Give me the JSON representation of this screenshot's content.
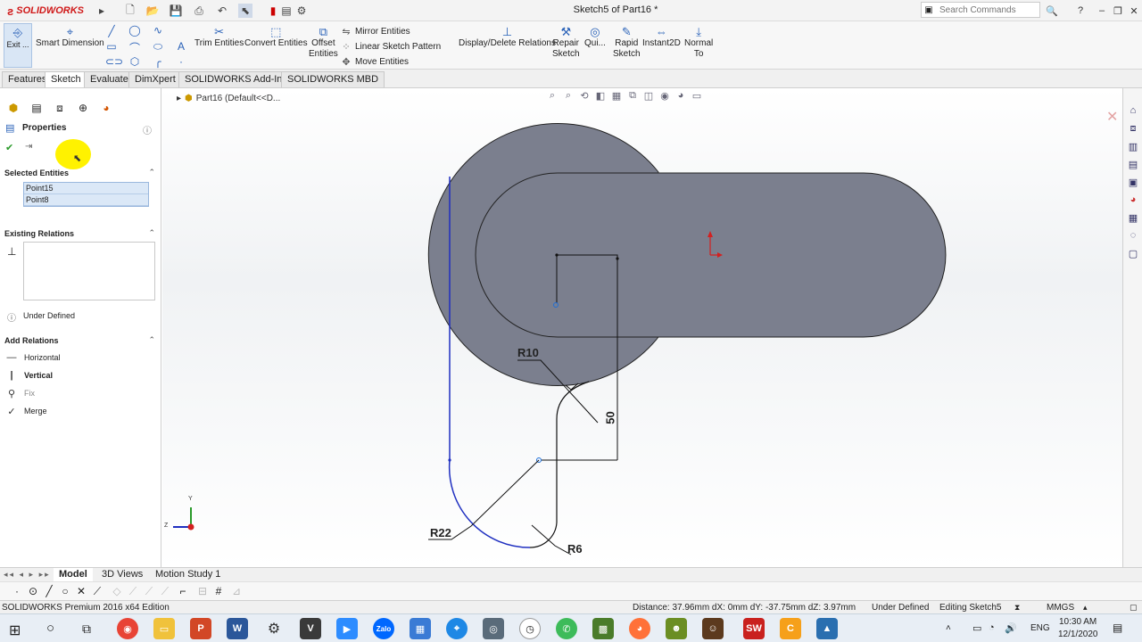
{
  "titlebar": {
    "app_name": "SOLIDWORKS",
    "window_title": "Sketch5 of Part16 *",
    "search_placeholder": "Search Commands",
    "help": "?"
  },
  "ribbon": {
    "exit_sketch": "Exit ...",
    "smart_dimension": "Smart Dimension",
    "trim_entities": "Trim Entities",
    "convert_entities": "Convert Entities",
    "offset_entities_1": "Offset",
    "offset_entities_2": "Entities",
    "mirror_entities": "Mirror Entities",
    "linear_pattern": "Linear Sketch Pattern",
    "move_entities": "Move Entities",
    "display_delete_relations": "Display/Delete Relations",
    "repair_sketch_1": "Repair",
    "repair_sketch_2": "Sketch",
    "quick_snaps": "Qui...",
    "rapid_sketch_1": "Rapid",
    "rapid_sketch_2": "Sketch",
    "instant2d": "Instant2D",
    "normal_to_1": "Normal",
    "normal_to_2": "To"
  },
  "command_tabs": [
    "Features",
    "Sketch",
    "Evaluate",
    "DimXpert",
    "SOLIDWORKS Add-Ins",
    "SOLIDWORKS MBD"
  ],
  "panel": {
    "title": "Properties",
    "selected_entities_label": "Selected Entities",
    "selected": [
      "Point15",
      "Point8"
    ],
    "existing_relations_label": "Existing Relations",
    "status": "Under Defined",
    "add_relations_label": "Add Relations",
    "relations": [
      "Horizontal",
      "Vertical",
      "Fix",
      "Merge"
    ]
  },
  "graphics": {
    "tree_root": "Part16  (Default<<D...",
    "dims": {
      "r10": "R10",
      "d50": "50",
      "r22": "R22",
      "r6": "R6"
    },
    "triad": {
      "y": "Y",
      "z": "Z"
    }
  },
  "bottom_tabs": [
    "Model",
    "3D Views",
    "Motion Study 1"
  ],
  "status": {
    "edition": "SOLIDWORKS Premium 2016 x64 Edition",
    "measure": "Distance: 37.96mm   dX: 0mm   dY: -37.75mm  dZ: 3.97mm",
    "defined": "Under Defined",
    "editing": "Editing Sketch5",
    "units": "MMGS"
  },
  "taskbar": {
    "lang": "ENG",
    "time": "10:30 AM",
    "date": "12/1/2020"
  },
  "colors": {
    "shaded_body": "#7b7f8e",
    "sketch_blue": "#1f2fc0",
    "origin_red": "#d32020",
    "accent": "#2a62b8"
  }
}
